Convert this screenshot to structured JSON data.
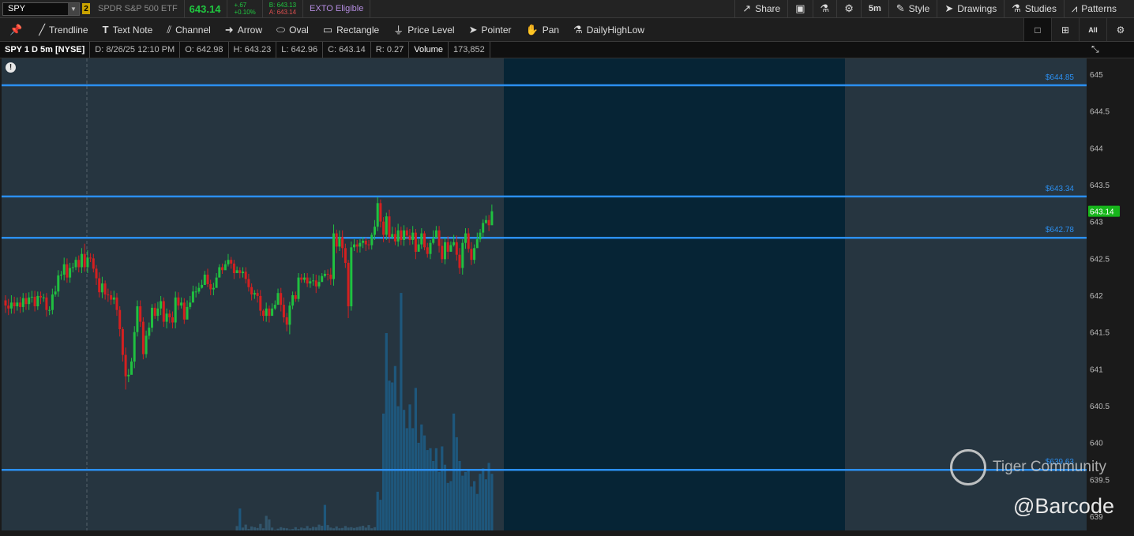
{
  "header": {
    "symbol": "SPY",
    "link_badge": "2",
    "description": "SPDR S&P 500 ETF",
    "last_price": "643.14",
    "change": "+.67",
    "change_pct": "+0.10%",
    "bid": "B: 643.13",
    "ask": "A: 643.14",
    "exto": "EXTO Eligible",
    "buttons": {
      "share": "Share",
      "timeframe": "5m",
      "style": "Style",
      "drawings": "Drawings",
      "studies": "Studies",
      "patterns": "Patterns"
    },
    "icons": [
      "share-icon",
      "screenshot-icon",
      "flask-icon",
      "gear-icon"
    ]
  },
  "toolbar": {
    "tools": [
      {
        "name": "trendline",
        "label": "Trendline",
        "icon": "trendline-icon"
      },
      {
        "name": "text-note",
        "label": "Text Note",
        "icon": "text-icon"
      },
      {
        "name": "channel",
        "label": "Channel",
        "icon": "channel-icon"
      },
      {
        "name": "arrow",
        "label": "Arrow",
        "icon": "arrow-icon"
      },
      {
        "name": "oval",
        "label": "Oval",
        "icon": "oval-icon"
      },
      {
        "name": "rectangle",
        "label": "Rectangle",
        "icon": "rectangle-icon"
      },
      {
        "name": "price-level",
        "label": "Price Level",
        "icon": "price-level-icon"
      },
      {
        "name": "pointer",
        "label": "Pointer",
        "icon": "pointer-icon"
      },
      {
        "name": "pan",
        "label": "Pan",
        "icon": "hand-icon"
      },
      {
        "name": "dailyhighlow",
        "label": "DailyHighLow",
        "icon": "flask-icon"
      }
    ],
    "view_all_label": "All"
  },
  "infobar": {
    "title": "SPY 1 D 5m [NYSE]",
    "date": "D: 8/26/25 12:10 PM",
    "open": "O: 642.98",
    "high": "H: 643.23",
    "low": "L: 642.96",
    "close": "C: 643.14",
    "range": "R: 0.27",
    "volume_label": "Volume",
    "volume": "173,852"
  },
  "chart": {
    "price_tag": "643.14",
    "price_axis_ticks": [
      "645",
      "644.5",
      "644",
      "643.5",
      "643",
      "642.5",
      "642",
      "641.5",
      "641",
      "640.5",
      "640",
      "639.5",
      "639"
    ],
    "levels": [
      {
        "label": "$644.85"
      },
      {
        "label": "$643.34"
      },
      {
        "label": "$642.78"
      },
      {
        "label": "$639.63"
      }
    ],
    "colors": {
      "up": "#20c040",
      "down": "#d42020",
      "level": "#2b8ff0",
      "session": "#062435",
      "bg": "#263540",
      "volume": "#1e5a80",
      "tag": "#17b51b"
    }
  },
  "chart_data": {
    "type": "candlestick",
    "symbol": "SPY",
    "interval": "5m",
    "ylim": [
      639,
      645.2
    ],
    "price_levels": [
      644.85,
      643.34,
      642.78,
      639.63
    ],
    "last": 643.14,
    "candles": [
      [
        641.93,
        641.86,
        642.0,
        641.76
      ],
      [
        641.86,
        641.82,
        641.95,
        641.73
      ],
      [
        641.82,
        641.9,
        642.0,
        641.75
      ],
      [
        641.9,
        641.85,
        641.98,
        641.75
      ],
      [
        641.85,
        641.9,
        641.97,
        641.79
      ],
      [
        641.9,
        641.84,
        641.98,
        641.76
      ],
      [
        641.84,
        641.96,
        642.03,
        641.77
      ],
      [
        641.96,
        641.88,
        642.03,
        641.8
      ],
      [
        641.88,
        641.97,
        642.04,
        641.8
      ],
      [
        641.97,
        641.98,
        642.06,
        641.9
      ],
      [
        641.98,
        641.85,
        642.06,
        641.78
      ],
      [
        641.85,
        641.99,
        642.05,
        641.8
      ],
      [
        641.99,
        641.97,
        642.05,
        641.88
      ],
      [
        641.97,
        641.97,
        642.02,
        641.91
      ],
      [
        641.97,
        641.8,
        642.03,
        641.71
      ],
      [
        641.8,
        641.8,
        641.85,
        641.73
      ],
      [
        641.8,
        642.01,
        642.09,
        641.74
      ],
      [
        642.01,
        642.05,
        642.13,
        641.98
      ],
      [
        642.05,
        642.27,
        642.34,
        641.98
      ],
      [
        642.27,
        642.28,
        642.33,
        642.21
      ],
      [
        642.28,
        642.42,
        642.51,
        642.2
      ],
      [
        642.42,
        642.24,
        642.5,
        642.17
      ],
      [
        642.24,
        642.37,
        642.44,
        642.17
      ],
      [
        642.37,
        642.38,
        642.44,
        642.31
      ],
      [
        642.38,
        642.48,
        642.52,
        642.34
      ],
      [
        642.48,
        642.38,
        642.54,
        642.31
      ],
      [
        642.38,
        642.56,
        642.64,
        642.3
      ],
      [
        642.56,
        642.38,
        642.7,
        642.32
      ],
      [
        642.38,
        642.51,
        642.61,
        642.3
      ],
      [
        642.51,
        642.5,
        642.57,
        642.45
      ],
      [
        642.5,
        642.36,
        642.56,
        642.31
      ],
      [
        642.36,
        642.23,
        642.41,
        642.14
      ],
      [
        642.23,
        642.04,
        642.31,
        641.97
      ],
      [
        642.04,
        642.16,
        642.25,
        641.96
      ],
      [
        642.16,
        642.01,
        642.2,
        641.94
      ],
      [
        642.01,
        642.0,
        642.09,
        641.91
      ],
      [
        642.0,
        641.94,
        642.06,
        641.87
      ],
      [
        641.94,
        641.97,
        642.06,
        641.88
      ],
      [
        641.97,
        641.8,
        642.03,
        641.72
      ],
      [
        641.8,
        641.54,
        641.85,
        641.44
      ],
      [
        641.54,
        641.19,
        641.57,
        641.1
      ],
      [
        641.19,
        640.9,
        641.29,
        640.72
      ],
      [
        640.9,
        640.92,
        641.0,
        640.82
      ],
      [
        640.92,
        641.1,
        641.15,
        641.02
      ],
      [
        641.1,
        641.5,
        641.58,
        641.01
      ],
      [
        641.5,
        641.85,
        641.93,
        641.44
      ],
      [
        641.85,
        641.64,
        641.93,
        641.57
      ],
      [
        641.64,
        641.2,
        641.7,
        641.13
      ],
      [
        641.2,
        641.45,
        641.52,
        641.15
      ],
      [
        641.45,
        641.56,
        641.63,
        641.4
      ],
      [
        641.56,
        641.83,
        641.88,
        641.5
      ],
      [
        641.83,
        641.72,
        641.89,
        641.68
      ],
      [
        641.72,
        641.82,
        641.91,
        641.65
      ],
      [
        641.82,
        641.92,
        641.99,
        641.73
      ],
      [
        641.92,
        641.64,
        641.97,
        641.57
      ],
      [
        641.64,
        641.75,
        641.82,
        641.55
      ],
      [
        641.75,
        641.7,
        641.8,
        641.62
      ],
      [
        641.7,
        641.63,
        641.78,
        641.55
      ],
      [
        641.63,
        641.97,
        642.05,
        641.55
      ],
      [
        641.97,
        641.86,
        642.04,
        641.8
      ],
      [
        641.86,
        641.9,
        641.97,
        641.82
      ],
      [
        641.9,
        641.67,
        641.96,
        641.61
      ],
      [
        641.67,
        641.84,
        641.93,
        641.77
      ],
      [
        641.84,
        641.9,
        641.99,
        641.81
      ],
      [
        641.9,
        642.05,
        642.13,
        641.98
      ],
      [
        642.05,
        642.05,
        642.12,
        641.97
      ],
      [
        642.05,
        642.1,
        642.17,
        642.02
      ],
      [
        642.1,
        642.14,
        642.21,
        642.09
      ],
      [
        642.14,
        642.28,
        642.33,
        642.19
      ],
      [
        642.28,
        642.15,
        642.36,
        642.11
      ],
      [
        642.15,
        642.08,
        642.21,
        642.0
      ],
      [
        642.08,
        642.1,
        642.17,
        642.0
      ],
      [
        642.1,
        642.24,
        642.3,
        642.17
      ],
      [
        642.24,
        642.38,
        642.42,
        642.32
      ],
      [
        642.38,
        642.34,
        642.43,
        642.29
      ],
      [
        642.34,
        642.42,
        642.47,
        642.38
      ],
      [
        642.42,
        642.48,
        642.56,
        642.39
      ],
      [
        642.48,
        642.43,
        642.52,
        642.36
      ],
      [
        642.43,
        642.3,
        642.48,
        642.22
      ],
      [
        642.3,
        642.34,
        642.39,
        642.3
      ],
      [
        642.34,
        642.3,
        642.38,
        642.23
      ],
      [
        642.3,
        642.32,
        642.38,
        642.24
      ],
      [
        642.32,
        642.22,
        642.38,
        642.16
      ],
      [
        642.22,
        642.11,
        642.29,
        642.05
      ],
      [
        642.11,
        642.01,
        642.16,
        641.93
      ],
      [
        642.01,
        642.03,
        642.07,
        641.95
      ],
      [
        642.03,
        641.99,
        642.08,
        641.9
      ],
      [
        641.99,
        641.79,
        642.07,
        641.72
      ],
      [
        641.79,
        641.72,
        641.81,
        641.65
      ],
      [
        641.72,
        641.82,
        641.9,
        641.64
      ],
      [
        641.82,
        641.72,
        641.86,
        641.63
      ],
      [
        641.72,
        641.82,
        641.89,
        641.73
      ],
      [
        641.82,
        641.87,
        641.93,
        641.8
      ],
      [
        641.87,
        642.03,
        642.09,
        641.95
      ],
      [
        642.03,
        641.87,
        642.1,
        641.78
      ],
      [
        641.87,
        641.7,
        641.97,
        641.63
      ],
      [
        641.7,
        641.6,
        641.76,
        641.51
      ],
      [
        641.6,
        641.86,
        641.91,
        641.47
      ],
      [
        641.86,
        642.0,
        642.05,
        641.81
      ],
      [
        642.0,
        641.95,
        642.05,
        641.91
      ],
      [
        641.95,
        642.24,
        642.3,
        641.91
      ],
      [
        642.24,
        642.21,
        642.29,
        642.17
      ],
      [
        642.21,
        642.24,
        642.3,
        642.17
      ],
      [
        642.24,
        642.16,
        642.3,
        642.11
      ],
      [
        642.16,
        642.19,
        642.24,
        642.1
      ],
      [
        642.19,
        642.2,
        642.29,
        642.13
      ],
      [
        642.2,
        642.12,
        642.28,
        642.03
      ],
      [
        642.12,
        642.18,
        642.27,
        642.09
      ],
      [
        642.18,
        642.26,
        642.3,
        642.18
      ],
      [
        642.26,
        642.29,
        642.34,
        642.24
      ],
      [
        642.29,
        642.28,
        642.35,
        642.2
      ],
      [
        642.28,
        642.22,
        642.37,
        642.14
      ],
      [
        642.22,
        642.84,
        642.96,
        642.13
      ],
      [
        642.84,
        642.66,
        642.89,
        642.57
      ],
      [
        642.66,
        642.79,
        642.88,
        642.6
      ],
      [
        642.79,
        642.64,
        642.88,
        642.51
      ],
      [
        642.64,
        642.44,
        642.7,
        642.37
      ],
      [
        642.44,
        641.85,
        642.48,
        641.69
      ],
      [
        641.85,
        642.65,
        642.73,
        641.79
      ],
      [
        642.65,
        642.69,
        642.76,
        642.6
      ],
      [
        642.69,
        642.66,
        642.75,
        642.58
      ],
      [
        642.66,
        642.71,
        642.76,
        642.58
      ],
      [
        642.71,
        642.74,
        642.79,
        642.64
      ],
      [
        642.74,
        642.69,
        642.78,
        642.6
      ],
      [
        642.69,
        642.68,
        642.75,
        642.62
      ],
      [
        642.68,
        642.82,
        642.85,
        642.62
      ],
      [
        642.82,
        642.93,
        643.02,
        642.75
      ],
      [
        642.93,
        643.25,
        643.33,
        642.87
      ],
      [
        643.25,
        643.0,
        643.3,
        642.92
      ],
      [
        643.0,
        642.82,
        643.06,
        642.72
      ],
      [
        642.82,
        643.07,
        643.12,
        642.75
      ],
      [
        643.07,
        642.79,
        643.16,
        642.71
      ],
      [
        642.79,
        642.83,
        642.93,
        642.76
      ],
      [
        642.83,
        642.73,
        642.92,
        642.68
      ],
      [
        642.73,
        642.88,
        642.97,
        642.66
      ],
      [
        642.88,
        642.75,
        642.93,
        642.68
      ],
      [
        642.75,
        642.88,
        642.95,
        642.67
      ],
      [
        642.88,
        642.81,
        642.92,
        642.76
      ],
      [
        642.81,
        642.75,
        642.9,
        642.68
      ],
      [
        642.75,
        642.85,
        642.94,
        642.69
      ],
      [
        642.85,
        642.59,
        642.9,
        642.49
      ],
      [
        642.59,
        642.69,
        642.76,
        642.62
      ],
      [
        642.69,
        642.84,
        642.91,
        642.63
      ],
      [
        642.84,
        642.65,
        642.87,
        642.61
      ],
      [
        642.65,
        642.56,
        642.71,
        642.51
      ],
      [
        642.56,
        642.71,
        642.75,
        642.49
      ],
      [
        642.71,
        642.78,
        642.88,
        642.69
      ],
      [
        642.78,
        642.88,
        642.94,
        642.81
      ],
      [
        642.88,
        642.67,
        642.94,
        642.58
      ],
      [
        642.67,
        642.49,
        642.76,
        642.44
      ],
      [
        642.49,
        642.72,
        642.78,
        642.42
      ],
      [
        642.72,
        642.59,
        642.8,
        642.49
      ],
      [
        642.59,
        642.68,
        642.73,
        642.59
      ],
      [
        642.68,
        642.72,
        642.82,
        642.66
      ],
      [
        642.72,
        642.55,
        642.81,
        642.47
      ],
      [
        642.55,
        642.37,
        642.64,
        642.29
      ],
      [
        642.37,
        642.71,
        642.76,
        642.28
      ],
      [
        642.71,
        642.84,
        642.91,
        642.63
      ],
      [
        642.84,
        642.63,
        642.91,
        642.58
      ],
      [
        642.63,
        642.48,
        642.72,
        642.41
      ],
      [
        642.48,
        642.64,
        642.69,
        642.43
      ],
      [
        642.64,
        642.76,
        642.85,
        642.71
      ],
      [
        642.76,
        642.85,
        642.9,
        642.72
      ],
      [
        642.85,
        642.98,
        643.03,
        642.79
      ],
      [
        642.98,
        643.02,
        643.08,
        642.97
      ],
      [
        643.02,
        642.95,
        643.09,
        642.87
      ],
      [
        642.95,
        643.14,
        643.23,
        642.96
      ]
    ],
    "volume_session_start_index": 111,
    "volume": [
      120,
      600,
      80,
      160,
      40,
      110,
      90,
      70,
      180,
      60,
      400,
      300,
      80,
      20,
      50,
      90,
      70,
      60,
      30,
      40,
      90,
      40,
      80,
      60,
      120,
      60,
      100,
      90,
      160,
      130,
      700,
      150,
      80,
      60,
      110,
      60,
      70,
      120,
      80,
      90,
      70,
      90,
      110,
      130,
      80,
      150,
      60,
      90,
      1060,
      840,
      3200,
      5400,
      4100,
      4050,
      4500,
      3400,
      6500,
      3300,
      2800,
      3450,
      2800,
      3900,
      2400,
      2900,
      2600,
      2200,
      2250,
      1900,
      2250,
      1600,
      2300,
      1800,
      1300,
      1350,
      3200,
      2550,
      1900,
      1500,
      1600,
      1650,
      1200,
      1350,
      1000,
      1550,
      1700,
      1400,
      1850,
      1550
    ]
  }
}
